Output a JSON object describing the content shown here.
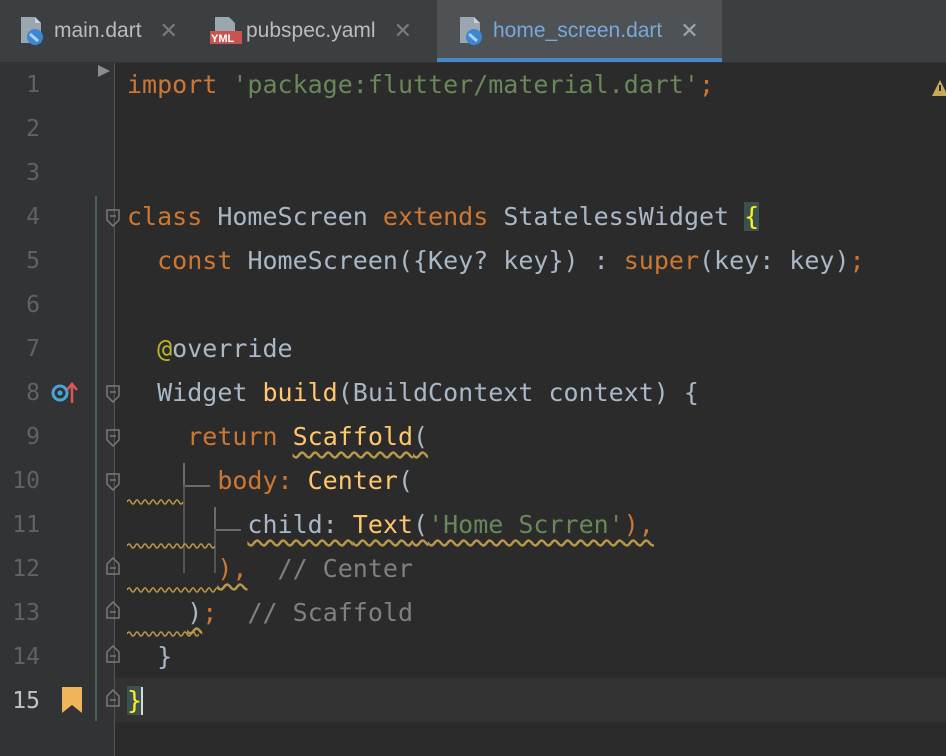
{
  "tabs": [
    {
      "label": "main.dart",
      "icon": "dart-file-icon",
      "active": false
    },
    {
      "label": "pubspec.yaml",
      "icon": "yaml-file-icon",
      "active": false
    },
    {
      "label": "home_screen.dart",
      "icon": "dart-file-icon",
      "active": true
    }
  ],
  "editor": {
    "line_numbers": [
      "1",
      "2",
      "3",
      "4",
      "5",
      "6",
      "7",
      "8",
      "9",
      "10",
      "11",
      "12",
      "13",
      "14",
      "15"
    ],
    "current_line": "15",
    "code": {
      "l1": {
        "kw": "import",
        "str": "'package:flutter/material.dart'",
        "end": ";"
      },
      "l4": {
        "kw": "class",
        "name": "HomeScreen",
        "kw2": "extends",
        "base": "StatelessWidget",
        "brace": "{"
      },
      "l5": {
        "kw": "const",
        "a": "HomeScreen({Key? key}) : ",
        "kw2": "super",
        "b": "(key: key)",
        "end": ";"
      },
      "l7": {
        "at": "@",
        "rest": "override"
      },
      "l8": {
        "a": "Widget ",
        "fn": "build",
        "b": "(BuildContext context) {"
      },
      "l9": {
        "kw": "return",
        "fn": "Scaffold",
        "p": "("
      },
      "l10": {
        "a": "body: ",
        "fn": "Center",
        "p": "("
      },
      "l11": {
        "a": "child: ",
        "fn": "Text",
        "p": "(",
        "str": "'Home Scrren'",
        "end": "),"
      },
      "l12": {
        "a": "),",
        "cm": "// Center"
      },
      "l13": {
        "a": ")",
        "semi": ";",
        "cm": "// Scaffold"
      },
      "l14": {
        "a": "}"
      },
      "l15": {
        "a": "}"
      }
    }
  }
}
